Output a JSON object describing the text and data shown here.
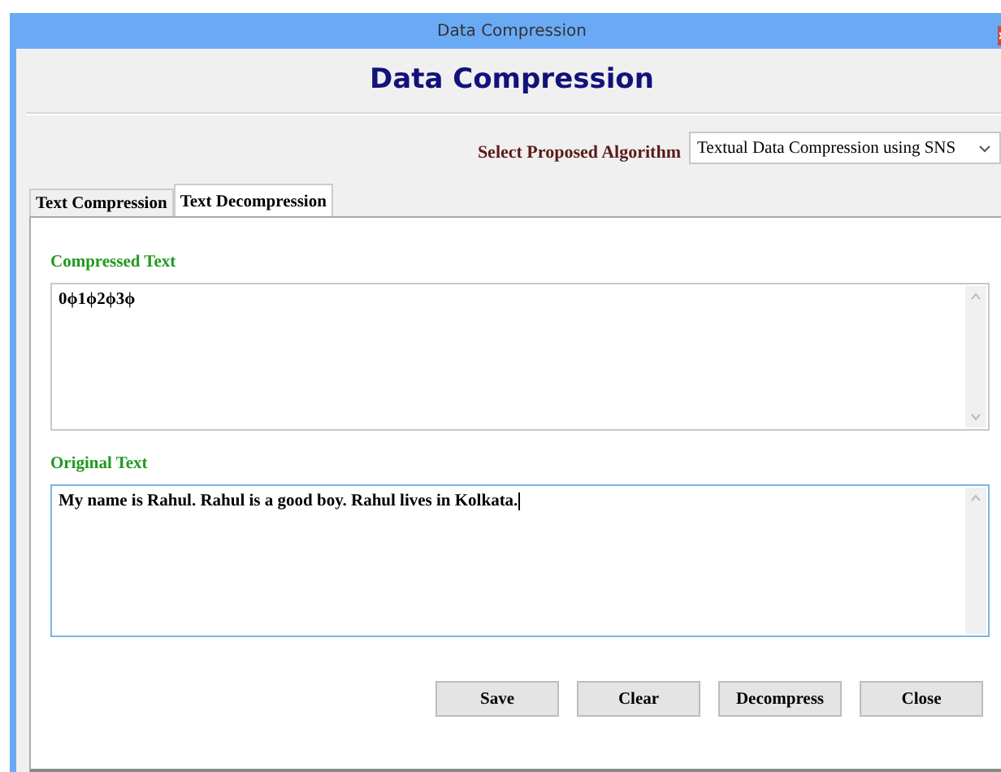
{
  "window": {
    "title": "Data Compression"
  },
  "heading": "Data Compression",
  "algorithm": {
    "label": "Select Proposed Algorithm",
    "value": "Textual Data Compression using SNS"
  },
  "tabs": [
    {
      "label": "Text Compression",
      "selected": false
    },
    {
      "label": "Text Decompression",
      "selected": true
    }
  ],
  "fields": [
    {
      "label": "Compressed Text",
      "value": "0ϕ1ϕ2ϕ3ϕ",
      "focused": false
    },
    {
      "label": "Original Text",
      "value": "My name is Rahul. Rahul is a good boy. Rahul lives in Kolkata.",
      "focused": true
    }
  ],
  "buttons": [
    "Save",
    "Clear",
    "Decompress",
    "Close"
  ]
}
